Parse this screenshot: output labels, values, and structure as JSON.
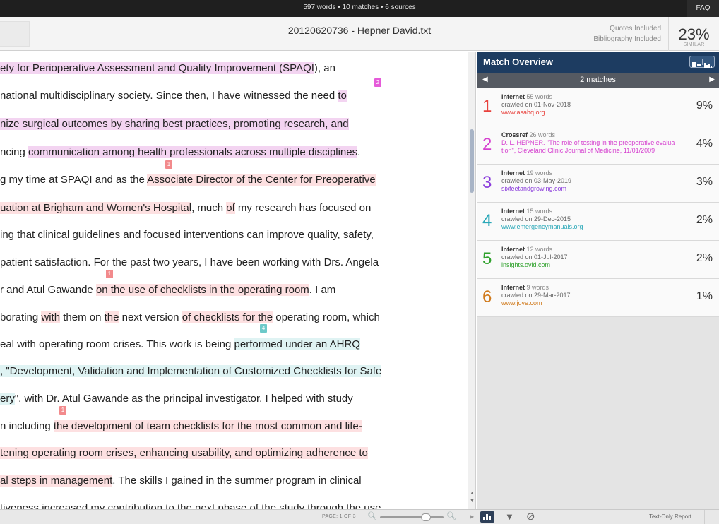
{
  "topbar": {
    "stats": "597 words • 10 matches • 6 sources",
    "faq": "FAQ"
  },
  "header": {
    "title": "20120620736 - Hepner David.txt",
    "quotes": "Quotes Included",
    "bibliography": "Bibliography Included",
    "similarity": "23%",
    "similar_label": "SIMILAR"
  },
  "document": {
    "lines": [
      [
        {
          "t": "ety for Perioperative Assessment and Quality Improvement (SPAQI",
          "h": "p1"
        },
        {
          "t": "), an",
          "h": ""
        }
      ],
      [
        {
          "t": "national multidisciplinary society.  Since then, I have witnessed the need ",
          "h": ""
        },
        {
          "t": "to",
          "h": "p1"
        }
      ],
      [
        {
          "t": "nize surgical outcomes by sharing best practices, promoting research, and",
          "h": "p1"
        }
      ],
      [
        {
          "t": "ncing ",
          "h": ""
        },
        {
          "t": "communication among health professionals across multiple disciplines",
          "h": "p1"
        },
        {
          "t": ".",
          "h": ""
        }
      ],
      [
        {
          "t": "g my time at SPAQI and as the ",
          "h": ""
        },
        {
          "t": "Associate Director of the Center for Preoperative",
          "h": "pink"
        }
      ],
      [
        {
          "t": "uation at Brigham and Women's Hospital",
          "h": "pink"
        },
        {
          "t": ", much ",
          "h": ""
        },
        {
          "t": "of",
          "h": "pink"
        },
        {
          "t": " my research has focused on",
          "h": ""
        }
      ],
      [
        {
          "t": "ing that clinical guidelines and focused interventions can improve quality, safety,",
          "h": ""
        }
      ],
      [
        {
          "t": "patient satisfaction.  For the past two years, I have been working with Drs. Angela",
          "h": ""
        }
      ],
      [
        {
          "t": "r and Atul Gawande ",
          "h": ""
        },
        {
          "t": "on the use of checklists in the operating room",
          "h": "pink"
        },
        {
          "t": ". I am",
          "h": ""
        }
      ],
      [
        {
          "t": "borating ",
          "h": ""
        },
        {
          "t": "with",
          "h": "pink"
        },
        {
          "t": " them on ",
          "h": ""
        },
        {
          "t": "the",
          "h": "pink"
        },
        {
          "t": " next version ",
          "h": ""
        },
        {
          "t": "of checklists for the",
          "h": "pink"
        },
        {
          "t": " operating room, which",
          "h": ""
        }
      ],
      [
        {
          "t": "eal with operating room crises. This work is being ",
          "h": ""
        },
        {
          "t": "performed under an AHRQ",
          "h": "cyan"
        }
      ],
      [
        {
          "t": ", \"Development, Validation and Implementation of Customized Checklists for Safe",
          "h": "cyan"
        }
      ],
      [
        {
          "t": "ery",
          "h": "cyan"
        },
        {
          "t": "\", with Dr. Atul Gawande as the principal investigator.  I helped with study",
          "h": ""
        }
      ],
      [
        {
          "t": "n including ",
          "h": ""
        },
        {
          "t": "the development of team checklists for the most common and life-",
          "h": "pink"
        }
      ],
      [
        {
          "t": "tening operating room crises, enhancing usability, and optimizing adherence to",
          "h": "pink"
        }
      ],
      [
        {
          "t": "al steps in management",
          "h": "pink"
        },
        {
          "t": ".  The skills I gained in the summer program in clinical",
          "h": ""
        }
      ],
      [
        {
          "t": "tiveness increased my contribution to the next phase of the study through the use",
          "h": ""
        }
      ]
    ],
    "markers": [
      "2",
      "1",
      "1",
      "4",
      "1"
    ]
  },
  "panel": {
    "title": "Match Overview",
    "matches": "2 matches",
    "prev": "◀",
    "next": "▶",
    "sources": [
      {
        "n": "1",
        "kind": "Internet",
        "words": "55 words",
        "info": "crawled on 01-Nov-2018",
        "url": "www.asahq.org",
        "pct": "9%",
        "color": "#e8413c"
      },
      {
        "n": "2",
        "kind": "Crossref",
        "words": "26 words",
        "info": "D. L. HEPNER. \"The role of testing in the preoperative evalua",
        "url": "tion\", Cleveland Clinic Journal of Medicine, 11/01/2009",
        "pct": "4%",
        "color": "#d53fcf"
      },
      {
        "n": "3",
        "kind": "Internet",
        "words": "19 words",
        "info": "crawled on 03-May-2019",
        "url": "sixfeetandgrowing.com",
        "pct": "3%",
        "color": "#8b3ddc"
      },
      {
        "n": "4",
        "kind": "Internet",
        "words": "15 words",
        "info": "crawled on 29-Dec-2015",
        "url": "www.emergencymanuals.org",
        "pct": "2%",
        "color": "#2aa8b8"
      },
      {
        "n": "5",
        "kind": "Internet",
        "words": "12 words",
        "info": "crawled on 01-Jul-2017",
        "url": "insights.ovid.com",
        "pct": "2%",
        "color": "#2fa12c"
      },
      {
        "n": "6",
        "kind": "Internet",
        "words": "9 words",
        "info": "crawled on 29-Mar-2017",
        "url": "www.jove.com",
        "pct": "1%",
        "color": "#d07a1c"
      }
    ]
  },
  "bottombar": {
    "page": "PAGE: 1 OF 3",
    "text_only": "Text-Only Report"
  }
}
